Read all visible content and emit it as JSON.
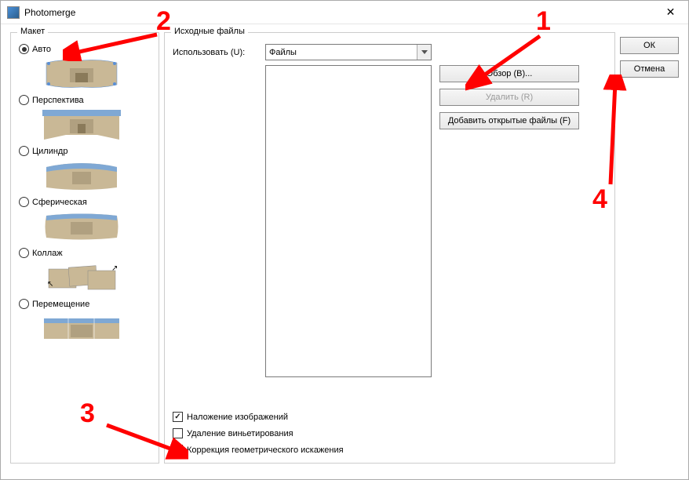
{
  "window": {
    "title": "Photomerge"
  },
  "layout": {
    "legend": "Макет",
    "options": [
      {
        "label": "Авто",
        "checked": true
      },
      {
        "label": "Перспектива",
        "checked": false
      },
      {
        "label": "Цилиндр",
        "checked": false
      },
      {
        "label": "Сферическая",
        "checked": false
      },
      {
        "label": "Коллаж",
        "checked": false
      },
      {
        "label": "Перемещение",
        "checked": false
      }
    ]
  },
  "source": {
    "legend": "Исходные файлы",
    "use_label": "Использовать (U):",
    "use_value": "Файлы",
    "browse": "Обзор (B)...",
    "remove": "Удалить (R)",
    "add_open": "Добавить открытые файлы (F)"
  },
  "checks": {
    "blend": {
      "label": "Наложение изображений",
      "checked": true
    },
    "vignette": {
      "label": "Удаление виньетирования",
      "checked": false
    },
    "geometric": {
      "label": "Коррекция геометрического искажения",
      "checked": false
    }
  },
  "actions": {
    "ok": "ОК",
    "cancel": "Отмена"
  },
  "annotations": {
    "n1": "1",
    "n2": "2",
    "n3": "3",
    "n4": "4"
  }
}
